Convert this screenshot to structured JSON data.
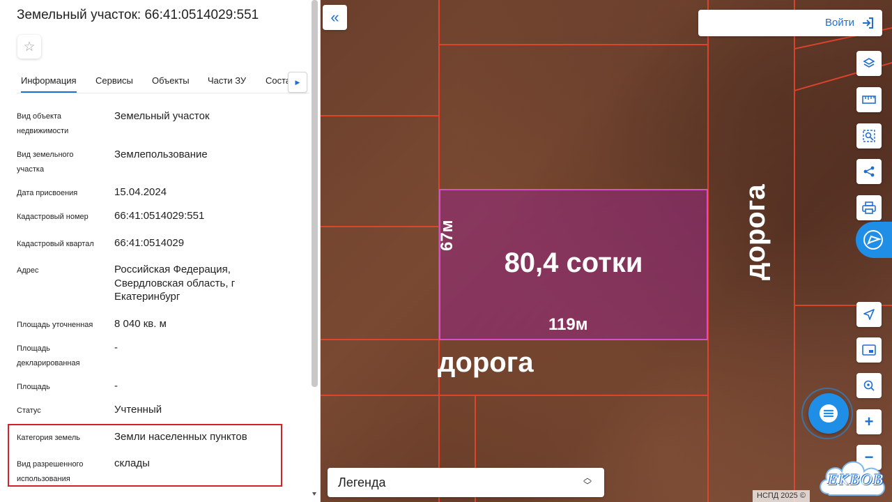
{
  "panel": {
    "title": "Земельный участок: 66:41:0514029:551",
    "tabs": [
      {
        "label": "Информация"
      },
      {
        "label": "Сервисы"
      },
      {
        "label": "Объекты"
      },
      {
        "label": "Части ЗУ"
      },
      {
        "label": "Соста"
      }
    ],
    "properties": [
      {
        "label": "Вид объекта недвижимости",
        "value": "Земельный участок"
      },
      {
        "label": "Вид земельного участка",
        "value": "Землепользование"
      },
      {
        "label": "Дата присвоения",
        "value": "15.04.2024"
      },
      {
        "label": "Кадастровый номер",
        "value": "66:41:0514029:551"
      },
      {
        "label": "Кадастровый квартал",
        "value": "66:41:0514029"
      },
      {
        "label": "Адрес",
        "value": "Российская Федерация, Свердловская область, г Екатеринбург"
      },
      {
        "label": "Площадь уточненная",
        "value": "8 040 кв. м"
      },
      {
        "label": "Площадь декларированная",
        "value": "-"
      },
      {
        "label": "Площадь",
        "value": "-"
      },
      {
        "label": "Статус",
        "value": "Учтенный"
      },
      {
        "label": "Категория земель",
        "value": "Земли населенных пунктов"
      },
      {
        "label": "Вид разрешенного использования",
        "value": "склады"
      }
    ]
  },
  "map": {
    "parcel_area": "80,4 сотки",
    "parcel_width": "119м",
    "parcel_height": "67м",
    "road_horizontal": "дорога",
    "road_vertical": "дорога",
    "login_label": "Войти",
    "legend_label": "Легенда",
    "copyright": "НСПД 2025 ©",
    "logo_text": "EKBOB"
  },
  "colors": {
    "accent": "#1f6fd1",
    "highlight": "#d3202b",
    "parcel_fill": "#962882",
    "boundary": "#e8452c"
  },
  "icons": {
    "collapse": "double-chevron-left-icon",
    "login": "sign-in-icon",
    "tools": [
      "layers-icon",
      "ruler-icon",
      "area-select-icon",
      "share-icon",
      "print-icon",
      "report-icon",
      "locate-icon",
      "picture-in-picture-icon",
      "search-location-icon",
      "zoom-in-icon",
      "zoom-out-icon",
      "chat-icon"
    ]
  }
}
